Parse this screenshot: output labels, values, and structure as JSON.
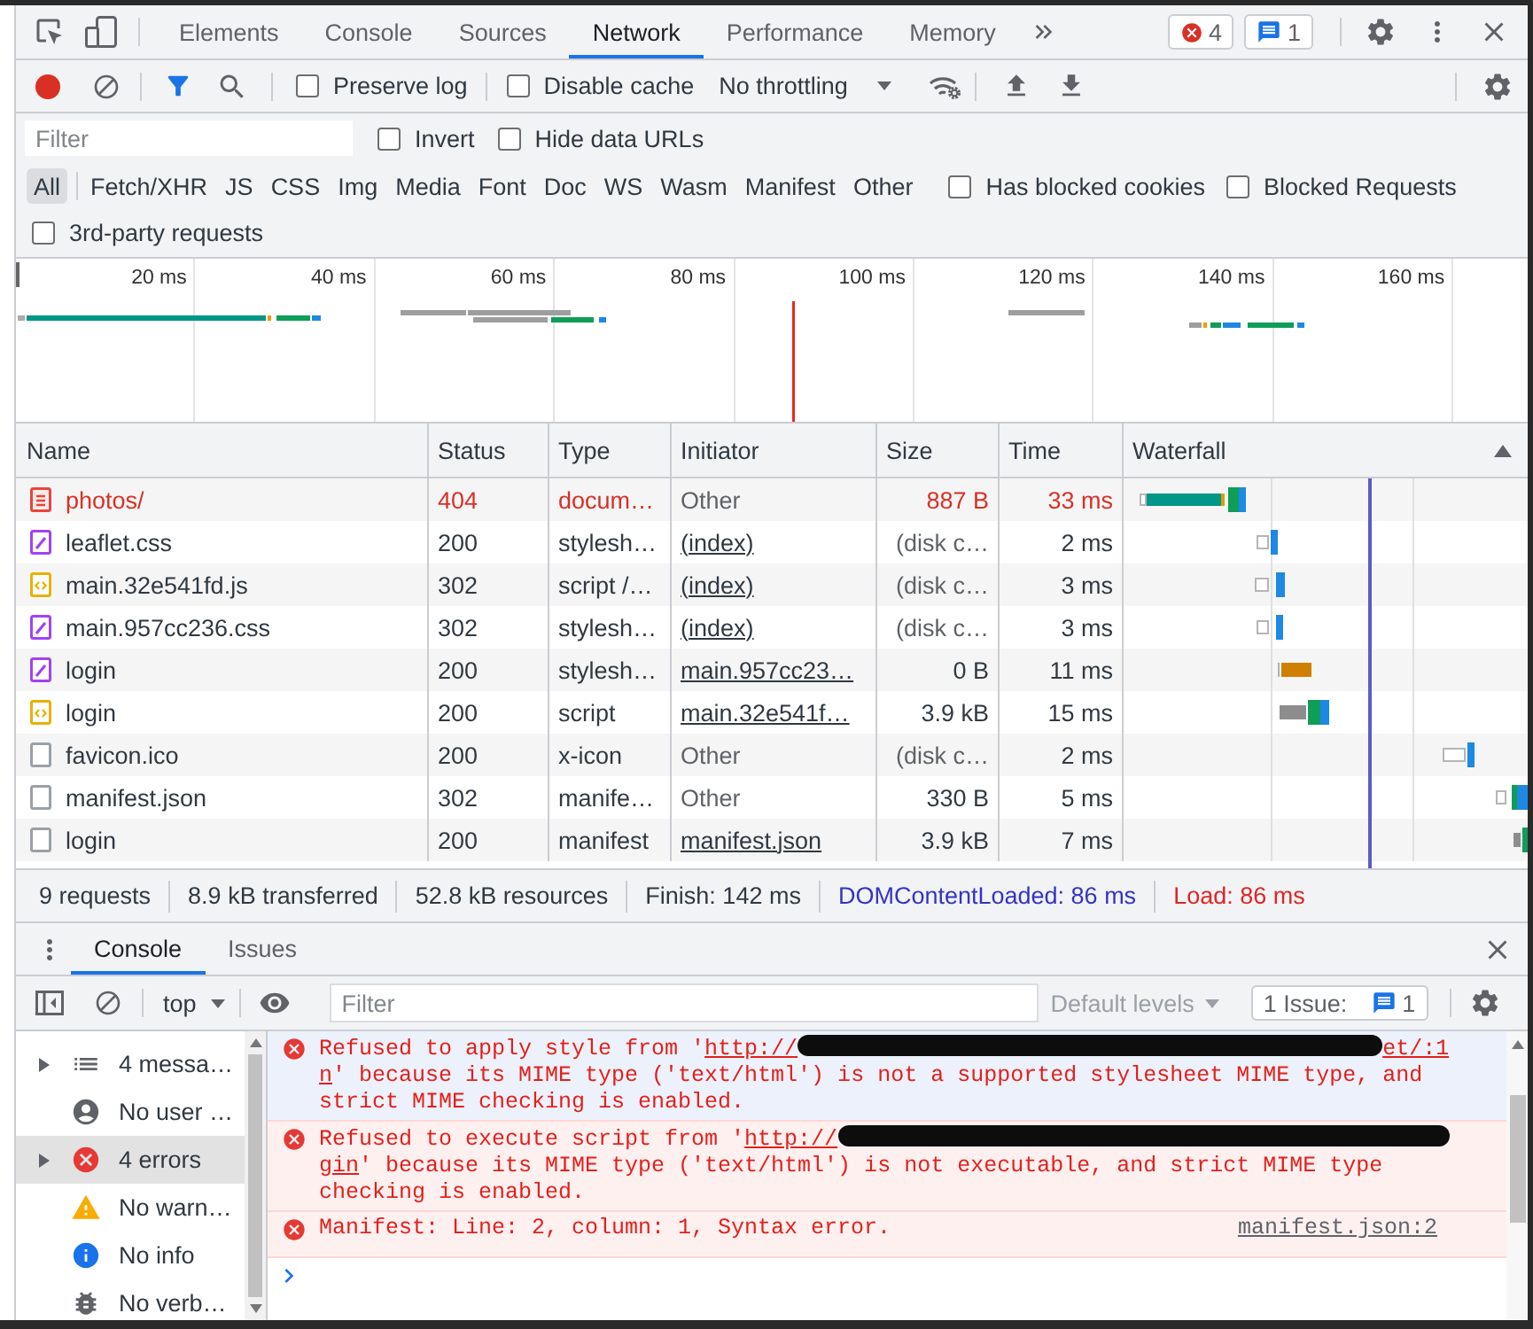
{
  "tab_bar": {
    "tabs": [
      {
        "label": "Elements",
        "selected": false
      },
      {
        "label": "Console",
        "selected": false
      },
      {
        "label": "Sources",
        "selected": false
      },
      {
        "label": "Network",
        "selected": true
      },
      {
        "label": "Performance",
        "selected": false
      },
      {
        "label": "Memory",
        "selected": false
      }
    ],
    "error_count": "4",
    "issue_count": "1"
  },
  "network_toolbar": {
    "recording": true,
    "filter_active": true,
    "options": [
      {
        "label": "Preserve log",
        "checked": false
      },
      {
        "label": "Disable cache",
        "checked": false
      }
    ],
    "throttling": "No throttling"
  },
  "filter_bar": {
    "placeholder": "Filter",
    "options": [
      {
        "label": "Invert",
        "checked": false
      },
      {
        "label": "Hide data URLs",
        "checked": false
      }
    ],
    "types": [
      {
        "label": "All",
        "selected": true
      },
      {
        "label": "Fetch/XHR",
        "selected": false
      },
      {
        "label": "JS",
        "selected": false
      },
      {
        "label": "CSS",
        "selected": false
      },
      {
        "label": "Img",
        "selected": false
      },
      {
        "label": "Media",
        "selected": false
      },
      {
        "label": "Font",
        "selected": false
      },
      {
        "label": "Doc",
        "selected": false
      },
      {
        "label": "WS",
        "selected": false
      },
      {
        "label": "Wasm",
        "selected": false
      },
      {
        "label": "Manifest",
        "selected": false
      },
      {
        "label": "Other",
        "selected": false
      }
    ],
    "blocked_options": [
      {
        "label": "Has blocked cookies",
        "checked": false
      },
      {
        "label": "Blocked Requests",
        "checked": false
      }
    ],
    "third_party": {
      "label": "3rd-party requests",
      "checked": false
    }
  },
  "overview": {
    "ticks": [
      "20 ms",
      "40 ms",
      "60 ms",
      "80 ms",
      "100 ms",
      "120 ms",
      "140 ms",
      "160 ms"
    ]
  },
  "table": {
    "columns": [
      {
        "label": "Name",
        "sorted": false
      },
      {
        "label": "Status",
        "sorted": false
      },
      {
        "label": "Type",
        "sorted": false
      },
      {
        "label": "Initiator",
        "sorted": false
      },
      {
        "label": "Size",
        "sorted": false
      },
      {
        "label": "Time",
        "sorted": false
      },
      {
        "label": "Waterfall",
        "sorted": true
      }
    ],
    "rows": [
      {
        "name": "photos/",
        "kind": "document",
        "failed": true,
        "status": "404",
        "type": "docum…",
        "initiator": "Other",
        "initiator_link": false,
        "size": "887 B",
        "size_cached": false,
        "time": "33 ms"
      },
      {
        "name": "leaflet.css",
        "kind": "stylesheet",
        "failed": false,
        "status": "200",
        "type": "stylesh…",
        "initiator": "(index)",
        "initiator_link": true,
        "size": "(disk c…",
        "size_cached": true,
        "time": "2 ms"
      },
      {
        "name": "main.32e541fd.js",
        "kind": "script",
        "failed": false,
        "status": "302",
        "type": "script /…",
        "initiator": "(index)",
        "initiator_link": true,
        "size": "(disk c…",
        "size_cached": true,
        "time": "3 ms"
      },
      {
        "name": "main.957cc236.css",
        "kind": "stylesheet",
        "failed": false,
        "status": "302",
        "type": "stylesh…",
        "initiator": "(index)",
        "initiator_link": true,
        "size": "(disk c…",
        "size_cached": true,
        "time": "3 ms"
      },
      {
        "name": "login",
        "kind": "stylesheet",
        "failed": false,
        "status": "200",
        "type": "stylesh…",
        "initiator": "main.957cc23…",
        "initiator_link": true,
        "size": "0 B",
        "size_cached": false,
        "time": "11 ms"
      },
      {
        "name": "login",
        "kind": "script",
        "failed": false,
        "status": "200",
        "type": "script",
        "initiator": "main.32e541f…",
        "initiator_link": true,
        "size": "3.9 kB",
        "size_cached": false,
        "time": "15 ms"
      },
      {
        "name": "favicon.ico",
        "kind": "other",
        "failed": false,
        "status": "200",
        "type": "x-icon",
        "initiator": "Other",
        "initiator_link": false,
        "size": "(disk c…",
        "size_cached": true,
        "time": "2 ms"
      },
      {
        "name": "manifest.json",
        "kind": "other",
        "failed": false,
        "status": "302",
        "type": "manife…",
        "initiator": "Other",
        "initiator_link": false,
        "size": "330 B",
        "size_cached": false,
        "time": "5 ms"
      },
      {
        "name": "login",
        "kind": "other",
        "failed": false,
        "status": "200",
        "type": "manifest",
        "initiator": "manifest.json",
        "initiator_link": true,
        "size": "3.9 kB",
        "size_cached": false,
        "time": "7 ms"
      }
    ]
  },
  "status_bar": [
    {
      "text": "9 requests",
      "kind": "plain"
    },
    {
      "text": "8.9 kB transferred",
      "kind": "plain"
    },
    {
      "text": "52.8 kB resources",
      "kind": "plain"
    },
    {
      "text": "Finish: 142 ms",
      "kind": "plain"
    },
    {
      "text": "DOMContentLoaded: 86 ms",
      "kind": "domcontentloaded"
    },
    {
      "text": "Load: 86 ms",
      "kind": "load"
    }
  ],
  "drawer": {
    "tabs": [
      {
        "label": "Console",
        "selected": true
      },
      {
        "label": "Issues",
        "selected": false
      }
    ]
  },
  "console_toolbar": {
    "context": "top",
    "placeholder": "Filter",
    "levels": {
      "label": "Default levels",
      "disabled": true
    },
    "issues": {
      "label": "1 Issue:",
      "count": "1"
    }
  },
  "console_sidebar": [
    {
      "label": "4 messa…",
      "kind": "messages",
      "expandable": true,
      "selected": false
    },
    {
      "label": "No user …",
      "kind": "user",
      "expandable": false,
      "selected": false
    },
    {
      "label": "4 errors",
      "kind": "error",
      "expandable": true,
      "selected": true
    },
    {
      "label": "No warn…",
      "kind": "warning",
      "expandable": false,
      "selected": false
    },
    {
      "label": "No info",
      "kind": "info",
      "expandable": false,
      "selected": false
    },
    {
      "label": "No verb…",
      "kind": "verbose",
      "expandable": false,
      "selected": false
    }
  ],
  "console_messages": [
    {
      "kind": "error",
      "highlighted": true,
      "text": "Refused to apply style from '",
      "url_parts": [
        "http://",
        "et/:1",
        "n"
      ],
      "redacted": true,
      "text_after": "' because its MIME type ('text/html') is not a supported stylesheet MIME type, and strict MIME checking is enabled."
    },
    {
      "kind": "error",
      "highlighted": false,
      "text": "Refused to execute script from '",
      "url_parts": [
        "http://",
        "gin"
      ],
      "redacted": true,
      "text_after": "' because its MIME type ('text/html') is not executable, and strict MIME type checking is enabled."
    },
    {
      "kind": "error",
      "highlighted": false,
      "text": "Manifest: Line: 2, column: 1, Syntax error.",
      "source": "manifest.json:2"
    }
  ]
}
